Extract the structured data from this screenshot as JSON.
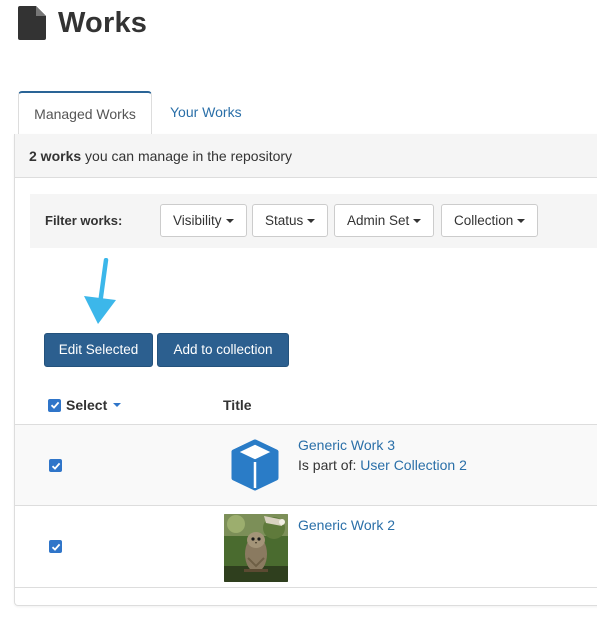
{
  "page": {
    "title": "Works",
    "icon": "document-icon"
  },
  "tabs": [
    {
      "label": "Managed Works",
      "active": true
    },
    {
      "label": "Your Works",
      "active": false
    }
  ],
  "summary": {
    "count": "2 works",
    "text": "you can manage in the repository"
  },
  "filters": {
    "label": "Filter works:",
    "buttons": [
      "Visibility",
      "Status",
      "Admin Set",
      "Collection"
    ]
  },
  "actions": {
    "edit_selected": "Edit Selected",
    "add_to_collection": "Add to collection"
  },
  "table": {
    "headers": {
      "select": "Select",
      "title": "Title"
    },
    "rows": [
      {
        "checked": true,
        "title": "Generic Work 3",
        "part_of_label": "Is part of:",
        "collection": "User Collection 2",
        "thumbnail": "cube-icon"
      },
      {
        "checked": true,
        "title": "Generic Work 2",
        "thumbnail": "owl-photo"
      }
    ]
  },
  "colors": {
    "link": "#2a6fa8",
    "primary_button": "#2c5f8f",
    "checkbox": "#2f75c9",
    "annotation_arrow": "#3cb7ea"
  }
}
